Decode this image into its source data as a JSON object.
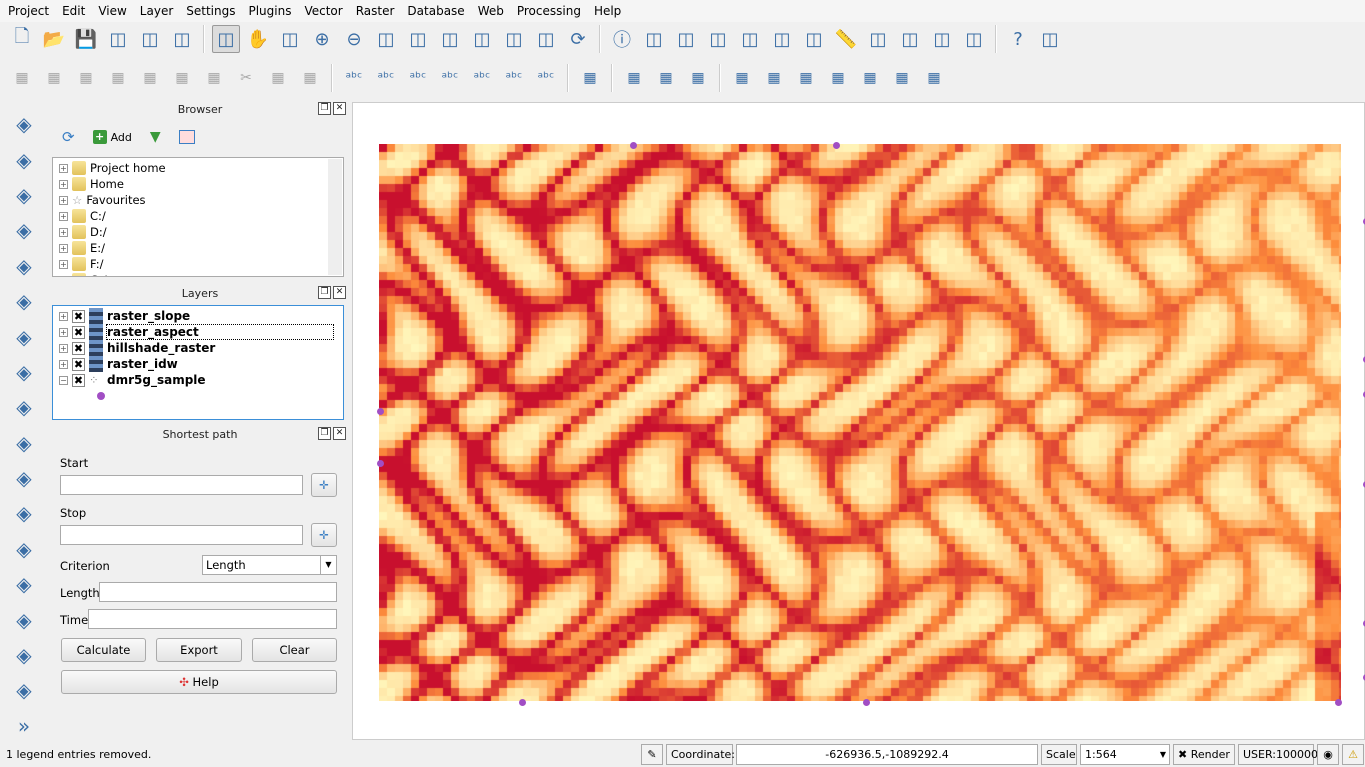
{
  "menu": [
    "Project",
    "Edit",
    "View",
    "Layer",
    "Settings",
    "Plugins",
    "Vector",
    "Raster",
    "Database",
    "Web",
    "Processing",
    "Help"
  ],
  "toolbar1": [
    "new-project",
    "open-project",
    "save-project",
    "save-as",
    "new-print-composer",
    "composer-manager",
    "touch-zoom",
    "pan",
    "pan-to-selection",
    "zoom-in",
    "zoom-out",
    "zoom-native",
    "zoom-full",
    "zoom-to-layer",
    "zoom-to-selection",
    "zoom-last",
    "zoom-next",
    "refresh",
    "identify",
    "select-by-location",
    "select-features",
    "deselect",
    "expression-select",
    "attribute-table",
    "field-calculator",
    "measure",
    "annotation",
    "text-annotation",
    "map-tips",
    "label",
    "help",
    "whats-this"
  ],
  "toolbar2": [
    "digitize",
    "edit-pencil",
    "save-edits",
    "add-feature",
    "move-feature",
    "node-tool",
    "delete-selected",
    "cut",
    "copy",
    "paste",
    "label-abc",
    "label-highlight",
    "label-pin",
    "label-show",
    "label-move",
    "label-rotate",
    "label-change",
    "csw",
    "db-manager-1",
    "db-manager-2",
    "db-manager-3",
    "vector-1",
    "vector-2",
    "vector-3",
    "vector-4",
    "vector-5",
    "vector-6",
    "vector-7"
  ],
  "left_toolbar": [
    "add-vector",
    "add-raster",
    "add-postgis",
    "add-spatialite",
    "add-mssql",
    "add-oracle",
    "add-db2",
    "add-wms",
    "add-wcs",
    "add-wfs",
    "add-delimited",
    "add-virtual",
    "new-shapefile",
    "new-spatialite",
    "add-gpx",
    "capture-point",
    "node-tool",
    "more"
  ],
  "browser": {
    "title": "Browser",
    "add_label": "Add",
    "items": [
      "Project home",
      "Home",
      "Favourites",
      "C:/",
      "D:/",
      "E:/",
      "F:/",
      "G:/"
    ]
  },
  "layers": {
    "title": "Layers",
    "items": [
      {
        "name": "raster_slope",
        "type": "raster"
      },
      {
        "name": "raster_aspect",
        "type": "raster"
      },
      {
        "name": "hillshade_raster",
        "type": "raster"
      },
      {
        "name": "raster_idw",
        "type": "raster"
      },
      {
        "name": "dmr5g_sample",
        "type": "point"
      }
    ]
  },
  "shortest_path": {
    "title": "Shortest path",
    "start_label": "Start",
    "start_value": "",
    "stop_label": "Stop",
    "stop_value": "",
    "criterion_label": "Criterion",
    "criterion_value": "Length",
    "length_label": "Length",
    "length_value": "",
    "time_label": "Time",
    "time_value": "",
    "calculate": "Calculate",
    "export": "Export",
    "clear": "Clear",
    "help": "Help"
  },
  "status": {
    "message": "1 legend entries removed.",
    "coordinate_label": "Coordinate:",
    "coordinate_value": "-626936.5,-1089292.4",
    "scale_label": "Scale",
    "scale_value": "1:564",
    "render_label": "Render",
    "render_checked": true,
    "crs": "USER:100000"
  },
  "colors": {
    "raster_low": "#fff7bc",
    "raster_mid": "#fd8d3c",
    "raster_high": "#c8102e",
    "point": "#a14ec4"
  }
}
